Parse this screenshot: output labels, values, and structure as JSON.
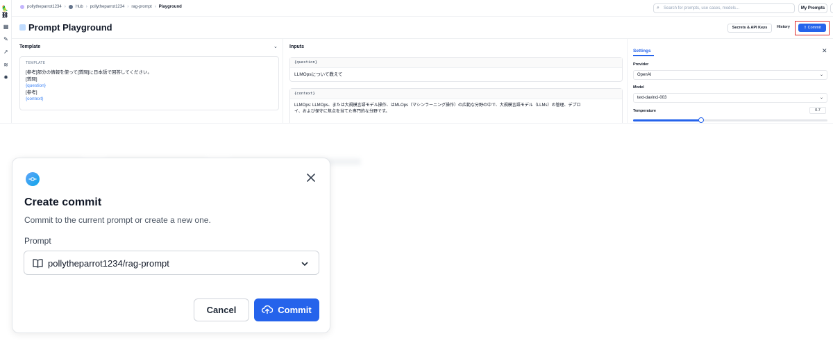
{
  "breadcrumb": {
    "user": "pollytheparrot1234",
    "hub": "Hub",
    "owner": "pollytheparrot1234",
    "repo": "rag-prompt",
    "current": "Playground"
  },
  "search": {
    "placeholder": "Search for prompts, use cases, models..."
  },
  "header_buttons": {
    "my_prompts": "My Prompts",
    "plus": "+"
  },
  "page": {
    "title": "Prompt Playground",
    "secrets": "Secrets & API Keys",
    "history": "History",
    "commit": "Commit"
  },
  "template_panel": {
    "title": "Template",
    "label": "TEMPLATE",
    "lines": [
      "[参考]部分の情報を使って[質問]に日本語で回答してください。",
      "[質問]",
      "{question}",
      "[参考]",
      "{context}"
    ]
  },
  "inputs_panel": {
    "title": "Inputs",
    "question_key": "{question}",
    "question_value": "LLMOpsについて教えて",
    "context_key": "{context}",
    "context_line1": "LLMOps: LLMOps、または大規模言語モデル操作、はMLOps（マシンラーニング操作）の広範な分野の中で、大規模言語モデル（LLMs）の管理、デプロ",
    "context_line2": "イ、および保守に焦点を当てた専門的な分野です。"
  },
  "settings_panel": {
    "tab": "Settings",
    "provider_label": "Provider",
    "provider_value": "OpenAI",
    "model_label": "Model",
    "model_value": "text-davinci-003",
    "temperature_label": "Temperature",
    "temperature_value": "0.7",
    "temperature_fraction": 0.35
  },
  "modal": {
    "title": "Create commit",
    "subtitle": "Commit to the current prompt or create a new one.",
    "prompt_label": "Prompt",
    "prompt_value": "pollytheparrot1234/rag-prompt",
    "cancel": "Cancel",
    "commit": "Commit"
  },
  "colors": {
    "accent": "#2563eb",
    "highlight": "#dc2626",
    "variable": "#3b82f6"
  },
  "icons": [
    "logo-icon",
    "grid-icon",
    "pen-icon",
    "rocket-icon",
    "database-icon",
    "settings-icon",
    "search-icon",
    "chevron-down-icon",
    "close-icon",
    "commit-icon",
    "book-icon",
    "cloud-upload-icon"
  ]
}
